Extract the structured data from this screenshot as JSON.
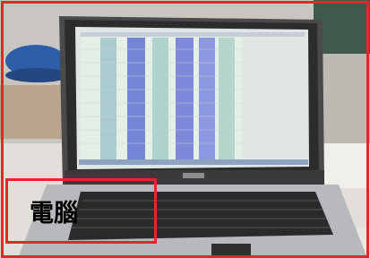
{
  "photo": {
    "subject_icon": "laptop-icon",
    "frame_color": "#e8262a"
  },
  "caption": {
    "label": "電腦"
  }
}
